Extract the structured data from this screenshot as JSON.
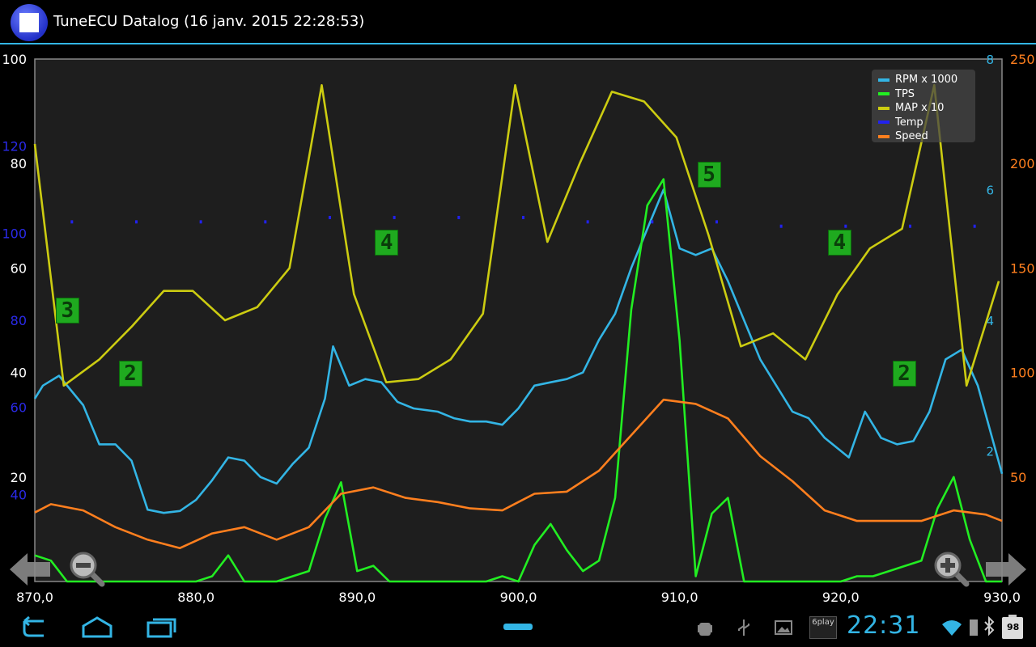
{
  "app": {
    "title": "TuneECU Datalog (16 janv. 2015 22:28:53)"
  },
  "colors": {
    "accent": "#33b5e5",
    "rpm": "#33b5e5",
    "tps": "#22ee22",
    "map": "#cccc11",
    "temp": "#2222ee",
    "speed": "#ff7f1e",
    "gear_bg": "#1faa1f"
  },
  "chart_data": {
    "type": "line",
    "x_axis": {
      "ticks": [
        "870,0",
        "880,0",
        "890,0",
        "900,0",
        "910,0",
        "920,0",
        "930,0"
      ],
      "range": [
        870,
        930
      ]
    },
    "axes": {
      "tps": {
        "ticks": [
          "100",
          "80",
          "60",
          "40",
          "20"
        ],
        "range": [
          0,
          100
        ]
      },
      "temp": {
        "ticks": [
          "120",
          "100",
          "80",
          "60",
          "40"
        ],
        "range": [
          20,
          140
        ]
      },
      "rpm": {
        "ticks": [
          "8",
          "6",
          "4",
          "2"
        ],
        "range": [
          0,
          8
        ]
      },
      "speed": {
        "ticks": [
          "250",
          "200",
          "150",
          "100",
          "50"
        ],
        "range": [
          0,
          250
        ]
      }
    },
    "legend": [
      "RPM x 1000",
      "TPS",
      "MAP x 10",
      "Temp",
      "Speed"
    ],
    "series": [
      {
        "name": "RPM x 1000",
        "axis": "rpm",
        "x": [
          870,
          870.5,
          871.5,
          873,
          874,
          875,
          876,
          877,
          878,
          879,
          880,
          881,
          882,
          883,
          884,
          885,
          886,
          887,
          888,
          888.5,
          889.5,
          890.5,
          891.5,
          892.5,
          893.5,
          895,
          896,
          897,
          898,
          899,
          900,
          901,
          902,
          903,
          904,
          905,
          906,
          907,
          908,
          909,
          910,
          911,
          912,
          913,
          914,
          915,
          916,
          917,
          918,
          919,
          920,
          920.5,
          921.5,
          922.5,
          923.5,
          924.5,
          925.5,
          926.5,
          927.5,
          928.5,
          930
        ],
        "values": [
          2.8,
          3.0,
          3.15,
          2.7,
          2.1,
          2.1,
          1.85,
          1.1,
          1.05,
          1.08,
          1.25,
          1.55,
          1.9,
          1.85,
          1.6,
          1.5,
          1.8,
          2.05,
          2.8,
          3.6,
          3.0,
          3.1,
          3.05,
          2.75,
          2.65,
          2.6,
          2.5,
          2.45,
          2.45,
          2.4,
          2.65,
          3.0,
          3.05,
          3.1,
          3.2,
          3.7,
          4.1,
          4.8,
          5.4,
          6.0,
          5.1,
          5.0,
          5.1,
          4.6,
          4.0,
          3.4,
          3.0,
          2.6,
          2.5,
          2.2,
          2.0,
          1.9,
          2.6,
          2.2,
          2.1,
          2.15,
          2.6,
          3.4,
          3.55,
          3.0,
          1.65
        ]
      },
      {
        "name": "TPS",
        "axis": "tps",
        "x": [
          870,
          871,
          872,
          873,
          874,
          875,
          876,
          877,
          878,
          879,
          880,
          881,
          882,
          883,
          884,
          885,
          886,
          887,
          888,
          889,
          890,
          891,
          892,
          893,
          894,
          895,
          896,
          897,
          898,
          899,
          900,
          901,
          902,
          903,
          904,
          905,
          906,
          907,
          908,
          909,
          910,
          911,
          912,
          913,
          914,
          915,
          916,
          917,
          918,
          919,
          920,
          921,
          922,
          923,
          924,
          925,
          926,
          927,
          928,
          929,
          930
        ],
        "values": [
          5,
          4,
          0,
          0,
          0,
          0,
          0,
          0,
          0,
          0,
          0,
          1,
          5,
          0,
          0,
          0,
          1,
          2,
          12,
          19,
          2,
          3,
          0,
          0,
          0,
          0,
          0,
          0,
          0,
          1,
          0,
          7,
          11,
          6,
          2,
          4,
          16,
          52,
          72,
          77,
          46,
          1,
          13,
          16,
          0,
          0,
          0,
          0,
          0,
          0,
          0,
          1,
          1,
          2,
          3,
          4,
          14,
          20,
          8,
          0,
          0
        ]
      },
      {
        "name": "MAP x 10",
        "axis": "rpm",
        "x": [
          870,
          871.8,
          874,
          876,
          878,
          879.8,
          881.8,
          883.8,
          885.8,
          887.8,
          889.8,
          891.8,
          893.8,
          895.8,
          897.8,
          899.8,
          901.8,
          903.8,
          905.8,
          907.8,
          909.8,
          911.8,
          913.8,
          915.8,
          917.8,
          919.8,
          921.8,
          923.8,
          925.8,
          927.8,
          929.8
        ],
        "values": [
          6.7,
          3.0,
          3.4,
          3.9,
          4.45,
          4.45,
          4.0,
          4.2,
          4.8,
          7.6,
          4.4,
          3.05,
          3.1,
          3.4,
          4.1,
          7.6,
          5.2,
          6.4,
          7.5,
          7.35,
          6.8,
          5.3,
          3.6,
          3.8,
          3.4,
          4.4,
          5.1,
          5.4,
          7.6,
          3.0,
          4.6
        ]
      },
      {
        "name": "Temp",
        "axis": "temp",
        "x": [
          872.3,
          876.3,
          880.3,
          884.3,
          888.3,
          892.3,
          896.3,
          900.3,
          904.3,
          908.3,
          912.3,
          916.3,
          920.3,
          924.3,
          928.3
        ],
        "values": [
          102.6,
          102.6,
          102.6,
          102.6,
          103.6,
          103.6,
          103.6,
          103.6,
          102.6,
          102.6,
          102.6,
          101.6,
          101.6,
          101.6,
          101.6
        ]
      },
      {
        "name": "Speed",
        "axis": "speed",
        "x": [
          870,
          871,
          873,
          875,
          877,
          879,
          881,
          883,
          885,
          887,
          889,
          891,
          893,
          895,
          897,
          899,
          901,
          903,
          905,
          907,
          909,
          911,
          913,
          915,
          917,
          919,
          921,
          923,
          925,
          927,
          929,
          930
        ],
        "values": [
          33,
          37,
          34,
          26,
          20,
          16,
          23,
          26,
          20,
          26,
          42,
          45,
          40,
          38,
          35,
          34,
          42,
          43,
          53,
          70,
          87,
          85,
          78,
          60,
          48,
          34,
          29,
          29,
          29,
          34,
          32,
          29
        ]
      }
    ],
    "gear_markers": [
      {
        "label": "3",
        "x": 872,
        "y_pct": 0.48
      },
      {
        "label": "2",
        "x": 875.9,
        "y_pct": 0.6
      },
      {
        "label": "4",
        "x": 891.8,
        "y_pct": 0.35
      },
      {
        "label": "5",
        "x": 911.8,
        "y_pct": 0.22
      },
      {
        "label": "4",
        "x": 919.9,
        "y_pct": 0.35
      },
      {
        "label": "2",
        "x": 923.9,
        "y_pct": 0.6
      }
    ]
  },
  "controls": {
    "prev": "arrow-left-icon",
    "next": "arrow-right-icon",
    "zoom_out": "zoom-out-icon",
    "zoom_in": "zoom-in-icon"
  },
  "system": {
    "clock": "22:31",
    "battery": "98",
    "notification_6play": "6play"
  }
}
